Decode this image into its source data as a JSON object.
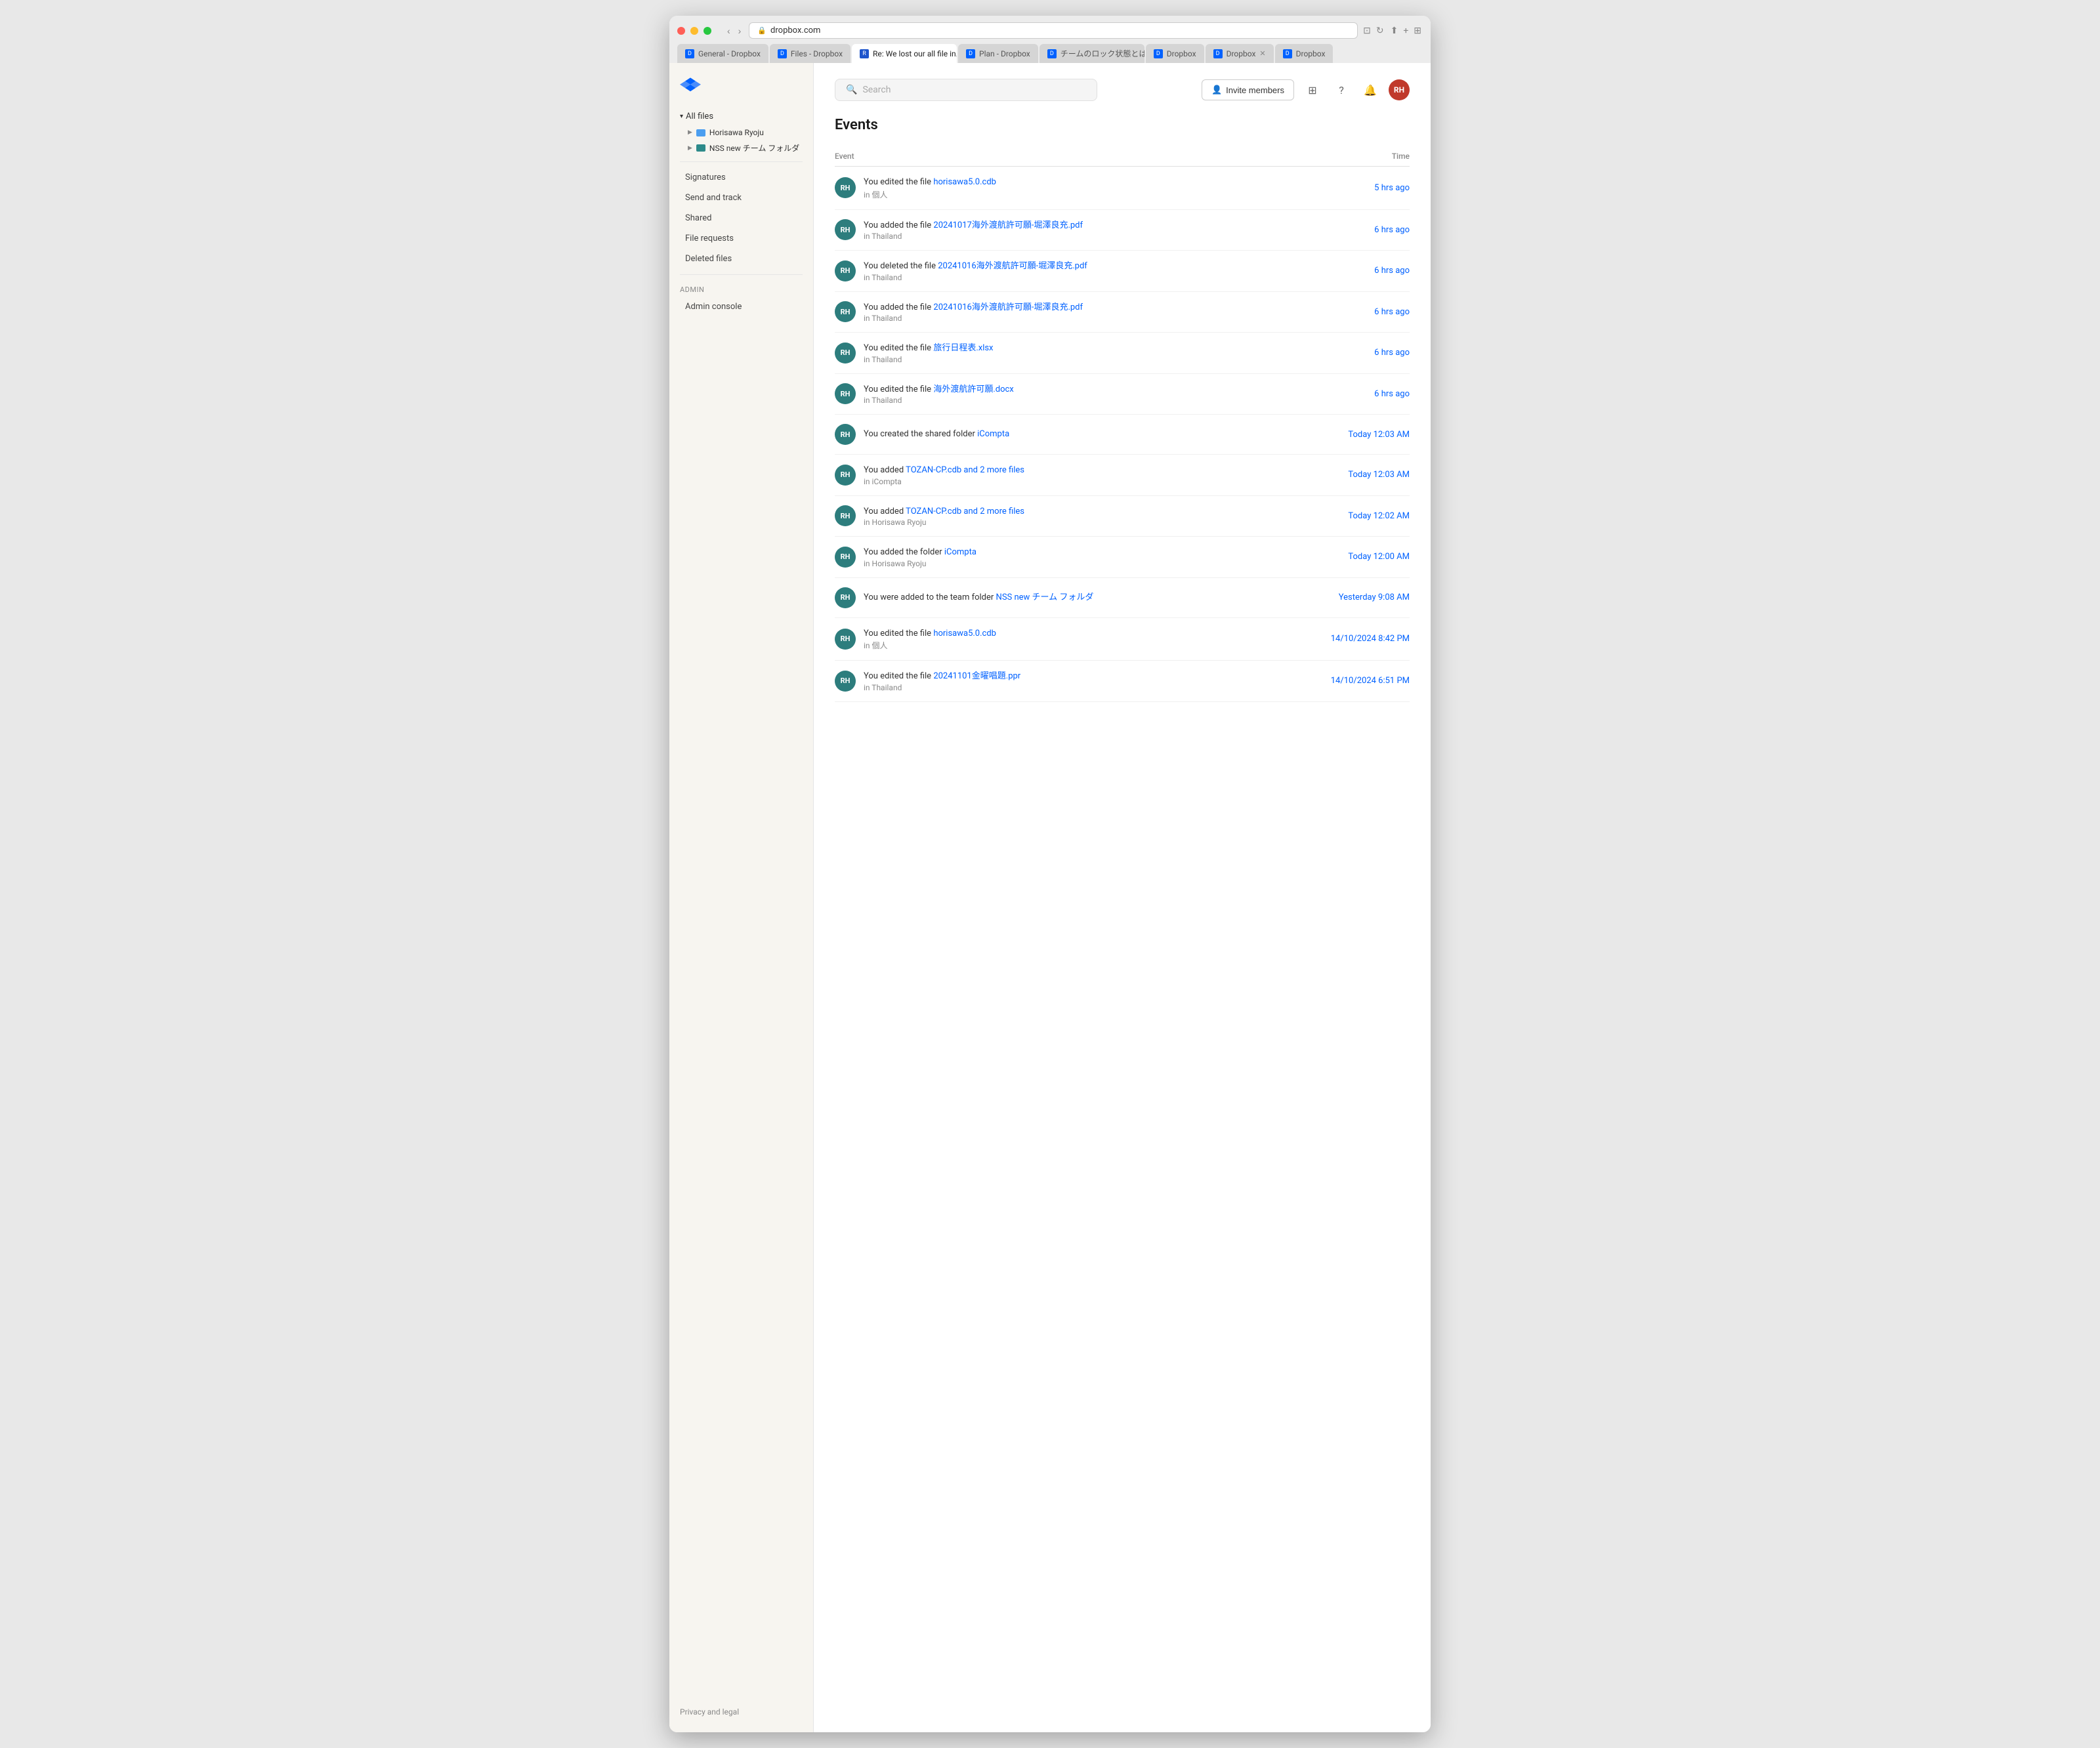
{
  "browser": {
    "url": "dropbox.com",
    "tabs": [
      {
        "id": "t1",
        "favicon_color": "#0061ff",
        "label": "General - Dropbox",
        "active": false
      },
      {
        "id": "t2",
        "favicon_color": "#0061ff",
        "label": "Files - Dropbox",
        "active": false
      },
      {
        "id": "t3",
        "favicon_color": "#1e55cc",
        "label": "Re: We lost our all file in...",
        "active": true
      },
      {
        "id": "t4",
        "favicon_color": "#0061ff",
        "label": "Plan - Dropbox",
        "active": false
      },
      {
        "id": "t5",
        "favicon_color": "#0061ff",
        "label": "チームのロック状態とは？ -...",
        "active": false
      },
      {
        "id": "t6",
        "favicon_color": "#0061ff",
        "label": "Dropbox",
        "active": false
      },
      {
        "id": "t7",
        "favicon_color": "#0061ff",
        "label": "Dropbox",
        "active": false
      },
      {
        "id": "t8",
        "favicon_color": "#0061ff",
        "label": "Dropbox",
        "active": false
      }
    ]
  },
  "sidebar": {
    "logo_alt": "Dropbox",
    "all_files_label": "All files",
    "folders": [
      {
        "name": "Horisawa Ryoju",
        "color": "blue"
      },
      {
        "name": "NSS new チーム フォルダ",
        "color": "teal"
      }
    ],
    "nav_items": [
      {
        "label": "Signatures"
      },
      {
        "label": "Send and track"
      },
      {
        "label": "Shared"
      },
      {
        "label": "File requests"
      },
      {
        "label": "Deleted files"
      }
    ],
    "admin_section": "Admin",
    "admin_items": [
      {
        "label": "Admin console"
      }
    ],
    "footer": "Privacy and legal"
  },
  "topbar": {
    "search_placeholder": "Search",
    "invite_btn": "Invite members",
    "avatar_initials": "RH"
  },
  "main": {
    "page_title": "Events",
    "col_event": "Event",
    "col_time": "Time",
    "events": [
      {
        "avatar": "RH",
        "text_before": "You edited the file",
        "link": "horisawa5.0.cdb",
        "text_after": "",
        "sub": "in 個人",
        "time": "5 hrs ago"
      },
      {
        "avatar": "RH",
        "text_before": "You added the file",
        "link": "20241017海外渡航許可願-堀澤良充.pdf",
        "text_after": "",
        "sub": "in Thailand",
        "time": "6 hrs ago"
      },
      {
        "avatar": "RH",
        "text_before": "You deleted the file",
        "link": "20241016海外渡航許可願-堀澤良充.pdf",
        "text_after": "",
        "sub": "in Thailand",
        "time": "6 hrs ago"
      },
      {
        "avatar": "RH",
        "text_before": "You added the file",
        "link": "20241016海外渡航許可願-堀澤良充.pdf",
        "text_after": "",
        "sub": "in Thailand",
        "time": "6 hrs ago"
      },
      {
        "avatar": "RH",
        "text_before": "You edited the file",
        "link": "旅行日程表.xlsx",
        "text_after": "",
        "sub": "in Thailand",
        "time": "6 hrs ago"
      },
      {
        "avatar": "RH",
        "text_before": "You edited the file",
        "link": "海外渡航許可願.docx",
        "text_after": "",
        "sub": "in Thailand",
        "time": "6 hrs ago"
      },
      {
        "avatar": "RH",
        "text_before": "You created the shared folder",
        "link": "iCompta",
        "text_after": "",
        "sub": "",
        "time": "Today 12:03 AM"
      },
      {
        "avatar": "RH",
        "text_before": "You added",
        "link": "TOZAN-CP.cdb and 2 more files",
        "text_after": "",
        "sub": "in iCompta",
        "time": "Today 12:03 AM"
      },
      {
        "avatar": "RH",
        "text_before": "You added",
        "link": "TOZAN-CP.cdb and 2 more files",
        "text_after": "",
        "sub": "in Horisawa Ryoju",
        "time": "Today 12:02 AM"
      },
      {
        "avatar": "RH",
        "text_before": "You added the folder",
        "link": "iCompta",
        "text_after": "",
        "sub": "in Horisawa Ryoju",
        "time": "Today 12:00 AM"
      },
      {
        "avatar": "RH",
        "text_before": "You were added to the team folder",
        "link": "NSS new チーム フォルダ",
        "text_after": "",
        "sub": "",
        "time": "Yesterday 9:08 AM"
      },
      {
        "avatar": "RH",
        "text_before": "You edited the file",
        "link": "horisawa5.0.cdb",
        "text_after": "",
        "sub": "in 個人",
        "time": "14/10/2024 8:42 PM"
      },
      {
        "avatar": "RH",
        "text_before": "You edited the file",
        "link": "20241101金曜唱題.ppr",
        "text_after": "",
        "sub": "in Thailand",
        "time": "14/10/2024 6:51 PM"
      }
    ]
  }
}
